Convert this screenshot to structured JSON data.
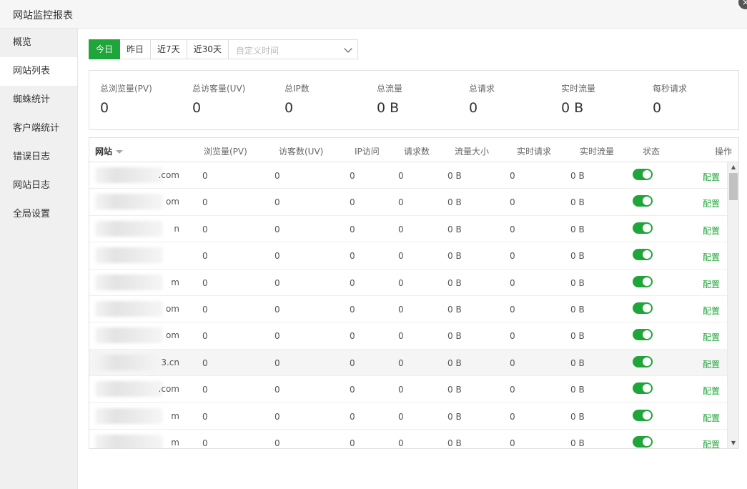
{
  "window": {
    "title": "网站监控报表",
    "close_icon": "×"
  },
  "sidebar": {
    "items": [
      {
        "label": "概览",
        "active": false
      },
      {
        "label": "网站列表",
        "active": true
      },
      {
        "label": "蜘蛛统计",
        "active": false
      },
      {
        "label": "客户端统计",
        "active": false
      },
      {
        "label": "错误日志",
        "active": false
      },
      {
        "label": "网站日志",
        "active": false
      },
      {
        "label": "全局设置",
        "active": false
      }
    ]
  },
  "date_filter": {
    "buttons": [
      "今日",
      "昨日",
      "近7天",
      "近30天"
    ],
    "active": "今日",
    "custom_placeholder": "自定义时间"
  },
  "stats": [
    {
      "label": "总浏览量(PV)",
      "value": "0"
    },
    {
      "label": "总访客量(UV)",
      "value": "0"
    },
    {
      "label": "总IP数",
      "value": "0"
    },
    {
      "label": "总流量",
      "value": "0 B"
    },
    {
      "label": "总请求",
      "value": "0"
    },
    {
      "label": "实时流量",
      "value": "0 B"
    },
    {
      "label": "每秒请求",
      "value": "0"
    }
  ],
  "table": {
    "headers": [
      "网站",
      "浏览量(PV)",
      "访客数(UV)",
      "IP访问",
      "请求数",
      "流量大小",
      "实时请求",
      "实时流量",
      "状态",
      "操作"
    ],
    "rows": [
      {
        "site_suffix": ".com",
        "pv": "0",
        "uv": "0",
        "ip": "0",
        "req": "0",
        "traffic": "0 B",
        "rt_req": "0",
        "rt_traffic": "0 B",
        "enabled": true,
        "action": "配置"
      },
      {
        "site_suffix": "om",
        "pv": "0",
        "uv": "0",
        "ip": "0",
        "req": "0",
        "traffic": "0 B",
        "rt_req": "0",
        "rt_traffic": "0 B",
        "enabled": true,
        "action": "配置"
      },
      {
        "site_suffix": "n",
        "pv": "0",
        "uv": "0",
        "ip": "0",
        "req": "0",
        "traffic": "0 B",
        "rt_req": "0",
        "rt_traffic": "0 B",
        "enabled": true,
        "action": "配置"
      },
      {
        "site_suffix": "",
        "pv": "0",
        "uv": "0",
        "ip": "0",
        "req": "0",
        "traffic": "0 B",
        "rt_req": "0",
        "rt_traffic": "0 B",
        "enabled": true,
        "action": "配置"
      },
      {
        "site_suffix": "m",
        "pv": "0",
        "uv": "0",
        "ip": "0",
        "req": "0",
        "traffic": "0 B",
        "rt_req": "0",
        "rt_traffic": "0 B",
        "enabled": true,
        "action": "配置"
      },
      {
        "site_suffix": "om",
        "pv": "0",
        "uv": "0",
        "ip": "0",
        "req": "0",
        "traffic": "0 B",
        "rt_req": "0",
        "rt_traffic": "0 B",
        "enabled": true,
        "action": "配置"
      },
      {
        "site_suffix": "om",
        "pv": "0",
        "uv": "0",
        "ip": "0",
        "req": "0",
        "traffic": "0 B",
        "rt_req": "0",
        "rt_traffic": "0 B",
        "enabled": true,
        "action": "配置"
      },
      {
        "site_suffix": "3.cn",
        "pv": "0",
        "uv": "0",
        "ip": "0",
        "req": "0",
        "traffic": "0 B",
        "rt_req": "0",
        "rt_traffic": "0 B",
        "enabled": true,
        "action": "配置",
        "highlight": true
      },
      {
        "site_suffix": ".com",
        "pv": "0",
        "uv": "0",
        "ip": "0",
        "req": "0",
        "traffic": "0 B",
        "rt_req": "0",
        "rt_traffic": "0 B",
        "enabled": true,
        "action": "配置"
      },
      {
        "site_suffix": "m",
        "pv": "0",
        "uv": "0",
        "ip": "0",
        "req": "0",
        "traffic": "0 B",
        "rt_req": "0",
        "rt_traffic": "0 B",
        "enabled": true,
        "action": "配置"
      },
      {
        "site_suffix": "m",
        "pv": "0",
        "uv": "0",
        "ip": "0",
        "req": "0",
        "traffic": "0 B",
        "rt_req": "0",
        "rt_traffic": "0 B",
        "enabled": true,
        "action": "配置"
      }
    ]
  },
  "colors": {
    "accent": "#20a53a"
  }
}
